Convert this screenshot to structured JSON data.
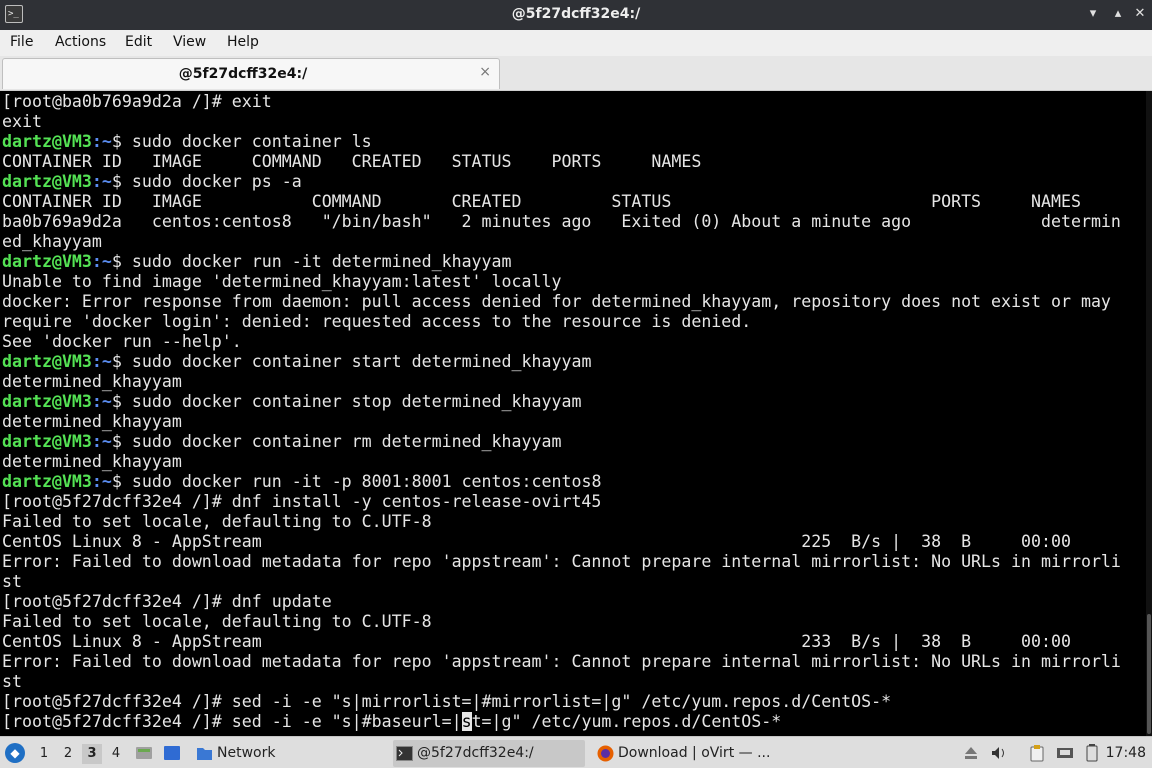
{
  "window": {
    "title": "@5f27dcff32e4:/",
    "app_icon": "terminal-icon",
    "controls": [
      "minimize-icon",
      "maximize-icon",
      "close-icon"
    ]
  },
  "menu": {
    "items": [
      "File",
      "Actions",
      "Edit",
      "View",
      "Help"
    ]
  },
  "tabs": [
    {
      "label": "@5f27dcff32e4:/",
      "close": "×"
    }
  ],
  "terminal": {
    "colors": {
      "background": "#000000",
      "text": "#e6e6e6",
      "user": "#54e354",
      "path": "#5a8cf0"
    },
    "lines": [
      {
        "text": "[root@ba0b769a9d2a /]# exit"
      },
      {
        "text": "exit"
      },
      {
        "user": "dartz@VM3",
        "path": ":~",
        "text": "$ sudo docker container ls"
      },
      {
        "text": "CONTAINER ID   IMAGE     COMMAND   CREATED   STATUS    PORTS     NAMES"
      },
      {
        "user": "dartz@VM3",
        "path": ":~",
        "text": "$ sudo docker ps -a"
      },
      {
        "text": "CONTAINER ID   IMAGE           COMMAND       CREATED         STATUS                          PORTS     NAMES"
      },
      {
        "text": "ba0b769a9d2a   centos:centos8   \"/bin/bash\"   2 minutes ago   Exited (0) About a minute ago             determin"
      },
      {
        "text": "ed_khayyam"
      },
      {
        "user": "dartz@VM3",
        "path": ":~",
        "text": "$ sudo docker run -it determined_khayyam"
      },
      {
        "text": "Unable to find image 'determined_khayyam:latest' locally"
      },
      {
        "text": "docker: Error response from daemon: pull access denied for determined_khayyam, repository does not exist or may"
      },
      {
        "text": "require 'docker login': denied: requested access to the resource is denied."
      },
      {
        "text": "See 'docker run --help'."
      },
      {
        "user": "dartz@VM3",
        "path": ":~",
        "text": "$ sudo docker container start determined_khayyam"
      },
      {
        "text": "determined_khayyam"
      },
      {
        "user": "dartz@VM3",
        "path": ":~",
        "text": "$ sudo docker container stop determined_khayyam"
      },
      {
        "text": "determined_khayyam"
      },
      {
        "user": "dartz@VM3",
        "path": ":~",
        "text": "$ sudo docker container rm determined_khayyam"
      },
      {
        "text": "determined_khayyam"
      },
      {
        "user": "dartz@VM3",
        "path": ":~",
        "text": "$ sudo docker run -it -p 8001:8001 centos:centos8"
      },
      {
        "text": "[root@5f27dcff32e4 /]# dnf install -y centos-release-ovirt45"
      },
      {
        "text": "Failed to set locale, defaulting to C.UTF-8"
      },
      {
        "text": "CentOS Linux 8 - AppStream                                                      225  B/s |  38  B     00:00"
      },
      {
        "text": "Error: Failed to download metadata for repo 'appstream': Cannot prepare internal mirrorlist: No URLs in mirrorli"
      },
      {
        "text": "st"
      },
      {
        "text": "[root@5f27dcff32e4 /]# dnf update"
      },
      {
        "text": "Failed to set locale, defaulting to C.UTF-8"
      },
      {
        "text": "CentOS Linux 8 - AppStream                                                      233  B/s |  38  B     00:00"
      },
      {
        "text": "Error: Failed to download metadata for repo 'appstream': Cannot prepare internal mirrorlist: No URLs in mirrorli"
      },
      {
        "text": "st"
      },
      {
        "text": "[root@5f27dcff32e4 /]# sed -i -e \"s|mirrorlist=|#mirrorlist=|g\" /etc/yum.repos.d/CentOS-*"
      },
      {
        "text": "[root@5f27dcff32e4 /]# sed -i -e \"s|#baseurl=|",
        "cursor_char": "s",
        "after": "t=|g\" /etc/yum.repos.d/CentOS-*"
      }
    ]
  },
  "taskbar": {
    "start_icon": "lxqt-start-icon",
    "workspaces": [
      "1",
      "2",
      "3",
      "4"
    ],
    "active_workspace": "3",
    "quicklaunch": [
      "file-manager-icon",
      "show-desktop-icon"
    ],
    "tasks": [
      {
        "icon": "folder-icon",
        "label": "Network"
      },
      {
        "icon": "terminal-icon",
        "label": "@5f27dcff32e4:/"
      },
      {
        "icon": "firefox-icon",
        "label": "Download | oVirt — ..."
      }
    ],
    "tray": [
      "eject-icon",
      "volume-icon",
      "clipboard-icon",
      "network-icon",
      "battery-icon"
    ],
    "clock": "17:48"
  }
}
